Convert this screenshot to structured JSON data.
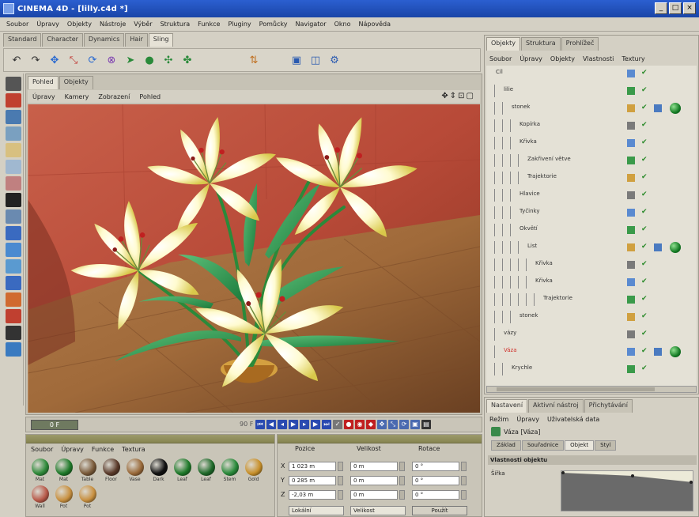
{
  "window": {
    "title": "CINEMA 4D - [lilly.c4d *]",
    "controls": [
      "_",
      "□",
      "×"
    ]
  },
  "menubar": [
    "Soubor",
    "Úpravy",
    "Objekty",
    "Nástroje",
    "Výběr",
    "Struktura",
    "Funkce",
    "Pluginy",
    "Pomůcky",
    "Navigator",
    "Okno",
    "Nápověda"
  ],
  "layout_tabs": [
    {
      "label": "Standard",
      "active": false
    },
    {
      "label": "Character",
      "active": false
    },
    {
      "label": "Dynamics",
      "active": false
    },
    {
      "label": "Hair",
      "active": false
    },
    {
      "label": "Sling",
      "active": true
    }
  ],
  "viewport": {
    "tabs": [
      {
        "label": "Pohled",
        "active": true
      },
      {
        "label": "Objekty",
        "active": false
      }
    ],
    "menu": [
      "Úpravy",
      "Kamery",
      "Zobrazení",
      "Pohled"
    ],
    "nav_icons": "✥⇕⊡▢"
  },
  "timeline": {
    "frame": "0 F",
    "total": "90 F"
  },
  "materials": {
    "menu": [
      "Soubor",
      "Úpravy",
      "Funkce",
      "Textura"
    ],
    "items": [
      {
        "name": "Mat",
        "color": "#2f8a3a"
      },
      {
        "name": "Mat",
        "color": "#1f7a2a"
      },
      {
        "name": "Table",
        "color": "#7a5a3a"
      },
      {
        "name": "Floor",
        "color": "#5a3a2a"
      },
      {
        "name": "Vase",
        "color": "#9a6a3a"
      },
      {
        "name": "Dark",
        "color": "#111111"
      },
      {
        "name": "Leaf",
        "color": "#1f7a2a"
      },
      {
        "name": "Leaf",
        "color": "#1f6a2a"
      },
      {
        "name": "Stem",
        "color": "#2a8a3a"
      },
      {
        "name": "Gold",
        "color": "#c8902a"
      },
      {
        "name": "Wall",
        "color": "#b85a4a"
      },
      {
        "name": "Pot",
        "color": "#c89040"
      },
      {
        "name": "Pot",
        "color": "#c89040"
      }
    ]
  },
  "coordinates": {
    "headers": [
      "Pozice",
      "Velikost",
      "Rotace"
    ],
    "rows": [
      {
        "axis": "X",
        "pos": "1 023 m",
        "size": "0 m",
        "rot": "0 °"
      },
      {
        "axis": "Y",
        "pos": "0 285 m",
        "size": "0 m",
        "rot": "0 °"
      },
      {
        "axis": "Z",
        "pos": "-2,03 m",
        "size": "0 m",
        "rot": "0 °"
      }
    ],
    "mode": "Lokální",
    "size_mode": "Velikost",
    "apply": "Použít"
  },
  "objects": {
    "tabs": [
      {
        "label": "Objekty",
        "active": true
      },
      {
        "label": "Struktura",
        "active": false
      },
      {
        "label": "Prohlížeč",
        "active": false
      }
    ],
    "menu": [
      "Soubor",
      "Úpravy",
      "Objekty",
      "Vlastnosti",
      "Textury"
    ],
    "tree": [
      {
        "name": "Cíl",
        "indent": 0,
        "red": false,
        "sphere": false
      },
      {
        "name": "lilie",
        "indent": 1,
        "red": false,
        "sphere": false
      },
      {
        "name": "stonek",
        "indent": 2,
        "red": false,
        "sphere": true
      },
      {
        "name": "Kopírka",
        "indent": 3,
        "red": false,
        "sphere": false
      },
      {
        "name": "Křivka",
        "indent": 3,
        "red": false,
        "sphere": false
      },
      {
        "name": "Zakřivení větve",
        "indent": 4,
        "red": false,
        "sphere": false
      },
      {
        "name": "Trajektorie",
        "indent": 4,
        "red": false,
        "sphere": false
      },
      {
        "name": "Hlavice",
        "indent": 3,
        "red": false,
        "sphere": false
      },
      {
        "name": "Tyčinky",
        "indent": 3,
        "red": false,
        "sphere": false
      },
      {
        "name": "Okvětí",
        "indent": 3,
        "red": false,
        "sphere": false
      },
      {
        "name": "List",
        "indent": 4,
        "red": false,
        "sphere": true
      },
      {
        "name": "Křivka",
        "indent": 5,
        "red": false,
        "sphere": false
      },
      {
        "name": "Křivka",
        "indent": 5,
        "red": false,
        "sphere": false
      },
      {
        "name": "Trajektorie",
        "indent": 6,
        "red": false,
        "sphere": false
      },
      {
        "name": "stonek",
        "indent": 3,
        "red": false,
        "sphere": false
      },
      {
        "name": "vázy",
        "indent": 1,
        "red": false,
        "sphere": false
      },
      {
        "name": "Váza",
        "indent": 1,
        "red": true,
        "sphere": true
      },
      {
        "name": "Krychle",
        "indent": 2,
        "red": false,
        "sphere": false
      }
    ]
  },
  "attributes": {
    "tabs": [
      {
        "label": "Nastavení",
        "active": true
      },
      {
        "label": "Aktivní nástroj",
        "active": false
      },
      {
        "label": "Přichytávání",
        "active": false
      }
    ],
    "menu": [
      "Režim",
      "Úpravy",
      "Uživatelská data"
    ],
    "object_name": "Váza [Váza]",
    "subtabs": [
      {
        "label": "Základ",
        "active": false
      },
      {
        "label": "Souřadnice",
        "active": false
      },
      {
        "label": "Objekt",
        "active": true
      },
      {
        "label": "Styl",
        "active": false
      }
    ],
    "section": "Vlastnosti objektu",
    "field": "Šířka"
  }
}
